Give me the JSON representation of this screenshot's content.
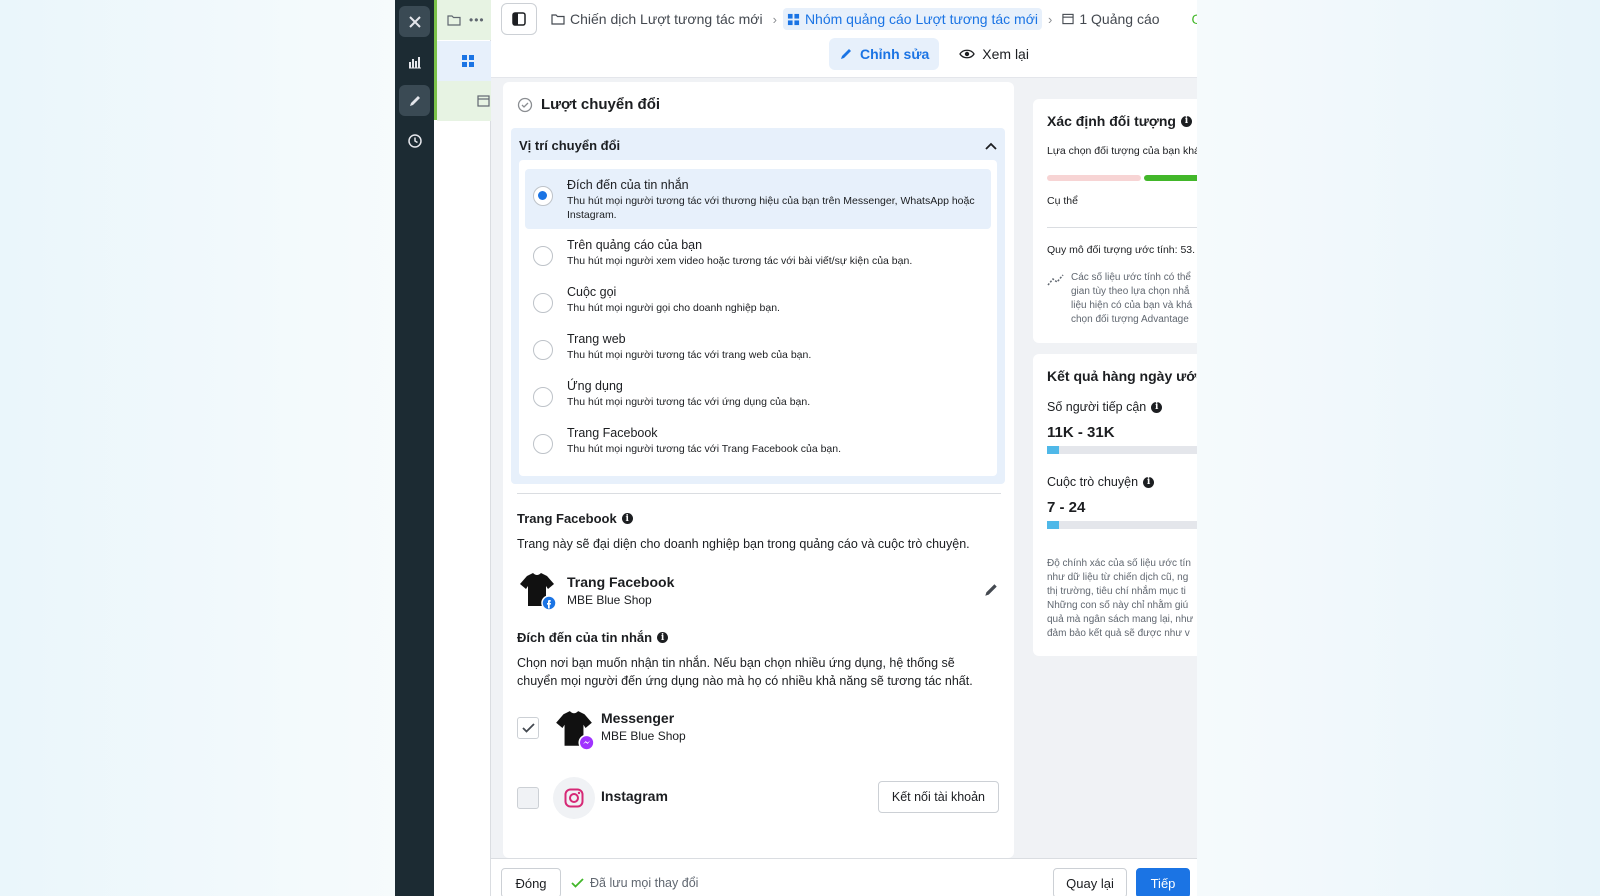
{
  "breadcrumb": {
    "campaign": "Chiến dịch Lượt tương tác mới",
    "ad_set": "Nhóm quảng cáo Lượt tương tác mới",
    "ads": "1 Quảng cáo"
  },
  "mode_tabs": {
    "edit": "Chỉnh sửa",
    "review": "Xem lại"
  },
  "section": {
    "title": "Lượt chuyển đổi",
    "location_header": "Vị trí chuyển đổi",
    "options": [
      {
        "title": "Đích đến của tin nhắn",
        "desc": "Thu hút mọi người tương tác với thương hiệu của bạn trên Messenger, WhatsApp hoặc Instagram.",
        "selected": true
      },
      {
        "title": "Trên quảng cáo của bạn",
        "desc": "Thu hút mọi người xem video hoặc tương tác với bài viết/sự kiện của bạn.",
        "selected": false
      },
      {
        "title": "Cuộc gọi",
        "desc": "Thu hút mọi người gọi cho doanh nghiệp bạn.",
        "selected": false
      },
      {
        "title": "Trang web",
        "desc": "Thu hút mọi người tương tác với trang web của bạn.",
        "selected": false
      },
      {
        "title": "Ứng dụng",
        "desc": "Thu hút mọi người tương tác với ứng dụng của bạn.",
        "selected": false
      },
      {
        "title": "Trang Facebook",
        "desc": "Thu hút mọi người tương tác với Trang Facebook của bạn.",
        "selected": false
      }
    ]
  },
  "facebook_page": {
    "heading": "Trang Facebook",
    "desc": "Trang này sẽ đại diện cho doanh nghiệp bạn trong quảng cáo và cuộc trò chuyện.",
    "name": "Trang Facebook",
    "shop": "MBE Blue Shop"
  },
  "message_destination": {
    "heading": "Đích đến của tin nhắn",
    "desc": "Chọn nơi bạn muốn nhận tin nhắn. Nếu bạn chọn nhiều ứng dụng, hệ thống sẽ chuyển mọi người đến ứng dụng nào mà họ có nhiều khả năng sẽ tương tác nhất.",
    "messenger": {
      "name": "Messenger",
      "shop": "MBE Blue Shop",
      "checked": true
    },
    "instagram": {
      "name": "Instagram",
      "checked": false,
      "connect_label": "Kết nối tài khoản"
    }
  },
  "audience": {
    "title": "Xác định đối tượng",
    "line1": "Lựa chọn đối tượng của bạn khá",
    "specific_label": "Cụ thể",
    "size_label": "Quy mô đối tượng ước tính: 53.",
    "note_lines": [
      "Các số liệu ước tính có thể",
      "gian tùy theo lựa chọn nhắ",
      "liệu hiện có của bạn và khá",
      "chọn đối tượng Advantage"
    ],
    "colors": {
      "low": "#f7d4d4",
      "good": "#42b72a"
    }
  },
  "daily_results": {
    "title": "Kết quả hàng ngày ước",
    "reach_label": "Số người tiếp cận",
    "reach_value": "11K - 31K",
    "reach_level": 0.08,
    "conversations_label": "Cuộc trò chuyện",
    "conversations_value": "7 - 24",
    "conversations_level": 0.08,
    "note_lines": [
      "Độ chính xác của số liệu ước tín",
      "như dữ liệu từ chiến dịch cũ, ng",
      "thị trường, tiêu chí nhắm mục ti",
      "Những con số này chỉ nhằm giú",
      "quả mà ngân sách mang lại, như",
      "đảm bảo kết quả sẽ được như v"
    ]
  },
  "footer": {
    "close_label": "Đóng",
    "saved_label": "Đã lưu mọi thay đổi",
    "back_label": "Quay lại",
    "next_label": "Tiếp"
  },
  "colors": {
    "accent": "#1b74e4",
    "rail": "#1c2b33",
    "green": "#7cc24a"
  }
}
